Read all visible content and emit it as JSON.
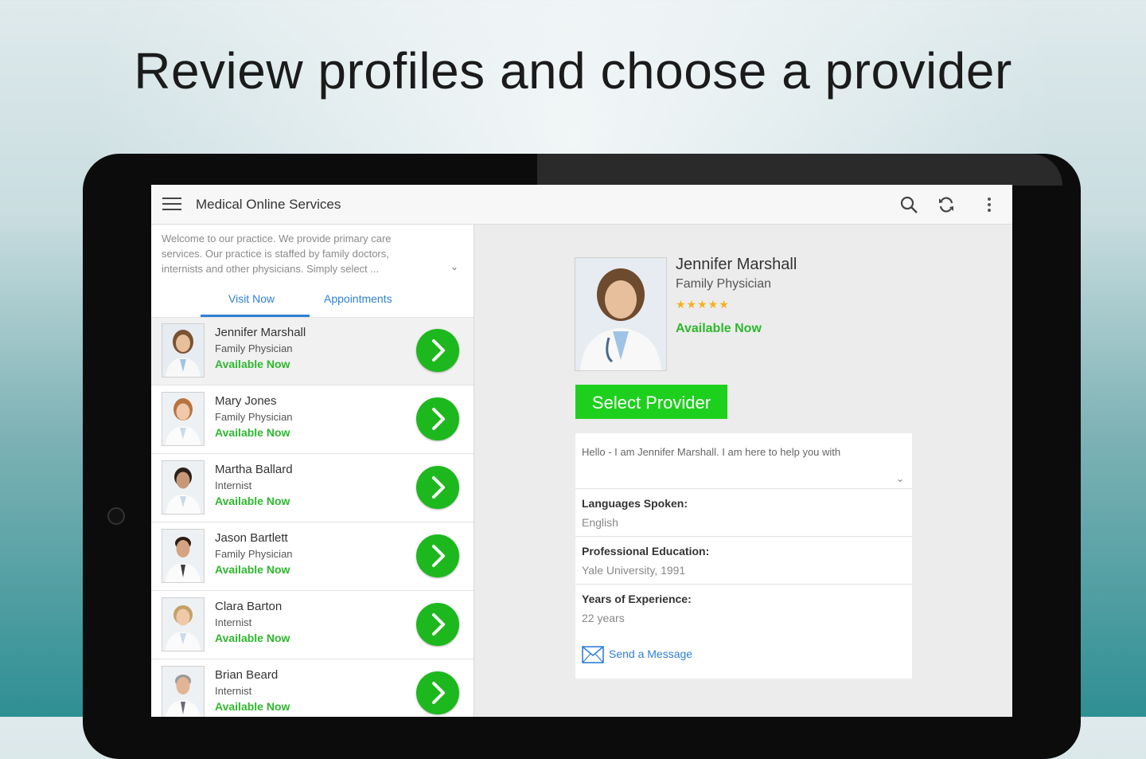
{
  "headline": "Review profiles and choose a provider",
  "app": {
    "title": "Medical Online Services",
    "welcome": "Welcome to our practice. We provide primary care services. Our practice is staffed by family doctors, internists and other physicians. Simply select ...",
    "tabs": [
      "Visit Now",
      "Appointments"
    ]
  },
  "providers": [
    {
      "name": "Jennifer Marshall",
      "specialty": "Family Physician",
      "status": "Available Now"
    },
    {
      "name": "Mary Jones",
      "specialty": "Family Physician",
      "status": "Available Now"
    },
    {
      "name": "Martha Ballard",
      "specialty": "Internist",
      "status": "Available Now"
    },
    {
      "name": "Jason Bartlett",
      "specialty": "Family Physician",
      "status": "Available Now"
    },
    {
      "name": "Clara Barton",
      "specialty": "Internist",
      "status": "Available Now"
    },
    {
      "name": "Brian Beard",
      "specialty": "Internist",
      "status": "Available Now"
    }
  ],
  "detail": {
    "name": "Jennifer Marshall",
    "specialty": "Family Physician",
    "rating": 5,
    "stars": "★★★★★",
    "status": "Available Now",
    "select_label": "Select Provider",
    "bio": "Hello - I am Jennifer Marshall. I am here to help you with",
    "fields": [
      {
        "label": "Languages Spoken:",
        "value": "English"
      },
      {
        "label": "Professional Education:",
        "value": "Yale University, 1991"
      },
      {
        "label": "Years of Experience:",
        "value": "22 years"
      }
    ],
    "message_label": "Send a Message"
  },
  "icons": [
    "menu-icon",
    "search-icon",
    "refresh-icon",
    "more-vert-icon",
    "chevron-right-icon",
    "chevron-down-icon",
    "mail-icon"
  ],
  "colors": {
    "accent": "#2f7fd6",
    "available": "#2eb82e",
    "primary_button": "#1ed01e",
    "star": "#f2b21c"
  }
}
